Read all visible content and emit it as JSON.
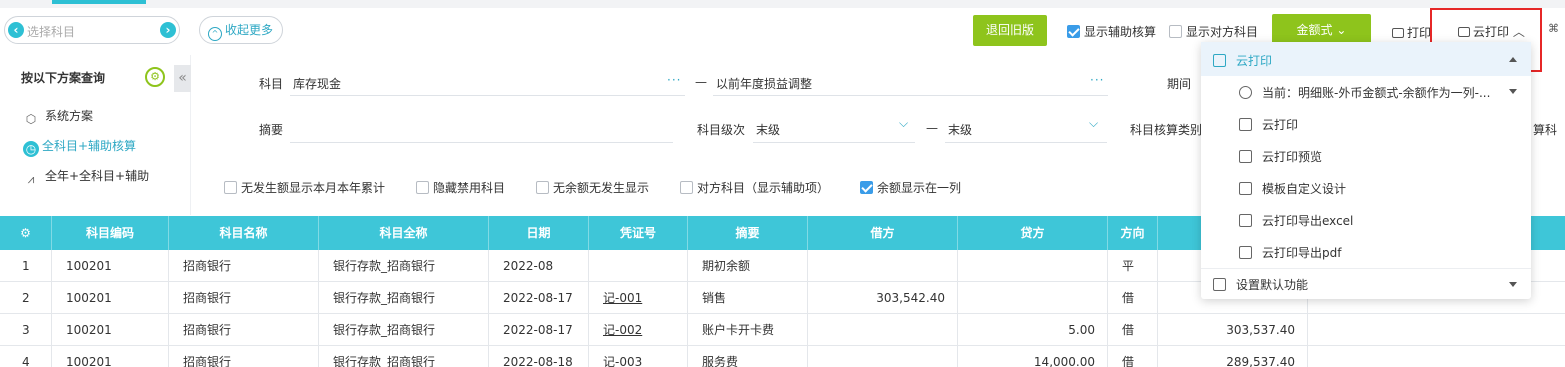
{
  "toolbar": {
    "subject_placeholder": "选择科目",
    "collapse_more": "收起更多",
    "old_version": "退回旧版",
    "show_aux": "显示辅助核算",
    "show_counter": "显示对方科目",
    "amount_mode": "金额式",
    "print": "打印",
    "cloud_print": "云打印"
  },
  "left_panel": {
    "title": "按以下方案查询",
    "items": [
      {
        "label": "系统方案",
        "icon": "cube-icon",
        "active": false
      },
      {
        "label": "全科目+辅助核算",
        "icon": "clock-icon",
        "active": true
      },
      {
        "label": "全年+全科目+辅助",
        "icon": "chart-icon",
        "active": false
      }
    ]
  },
  "filters": {
    "subject_label": "科目",
    "subject_from": "库存现金",
    "subject_dash": "—",
    "subject_to": "以前年度损益调整",
    "period_label": "期间",
    "summary_label": "摘要",
    "level_label": "科目级次",
    "level_from": "末级",
    "level_dash": "—",
    "level_to": "末级",
    "aux_type_label": "科目核算类别",
    "aux_type_value": "算科",
    "checks": [
      {
        "label": "无发生额显示本月本年累计",
        "checked": false
      },
      {
        "label": "隐藏禁用科目",
        "checked": false
      },
      {
        "label": "无余额无发生显示",
        "checked": false
      },
      {
        "label": "对方科目（显示辅助项）",
        "checked": false
      },
      {
        "label": "余额显示在一列",
        "checked": true
      }
    ]
  },
  "table": {
    "headers": [
      "科目编码",
      "科目名称",
      "科目全称",
      "日期",
      "凭证号",
      "摘要",
      "借方",
      "贷方",
      "方向"
    ],
    "rows": [
      {
        "no": "1",
        "code": "100201",
        "name": "招商银行",
        "full": "银行存款_招商银行",
        "date": "2022-08",
        "voucher": "",
        "summary": "期初余额",
        "debit": "",
        "credit": "",
        "dir": "平",
        "balance": ""
      },
      {
        "no": "2",
        "code": "100201",
        "name": "招商银行",
        "full": "银行存款_招商银行",
        "date": "2022-08-17",
        "voucher": "记-001",
        "summary": "销售",
        "debit": "303,542.40",
        "credit": "",
        "dir": "借",
        "balance": ""
      },
      {
        "no": "3",
        "code": "100201",
        "name": "招商银行",
        "full": "银行存款_招商银行",
        "date": "2022-08-17",
        "voucher": "记-002",
        "summary": "账户卡开卡费",
        "debit": "",
        "credit": "5.00",
        "dir": "借",
        "balance": "303,537.40"
      },
      {
        "no": "4",
        "code": "100201",
        "name": "招商银行",
        "full": "银行存款_招商银行",
        "date": "2022-08-18",
        "voucher": "记-003",
        "summary": "服务费",
        "debit": "",
        "credit": "14,000.00",
        "dir": "借",
        "balance": "289,537.40"
      }
    ]
  },
  "dropdown": {
    "header": "云打印",
    "current": "当前：明细账-外币金额式-余额作为一列-...",
    "items": [
      "云打印",
      "云打印预览",
      "模板自定义设计",
      "云打印导出excel",
      "云打印导出pdf"
    ],
    "footer": "设置默认功能"
  },
  "colors": {
    "accent": "#3ec6d8",
    "green": "#8ec41c",
    "highlight": "#e62727"
  }
}
